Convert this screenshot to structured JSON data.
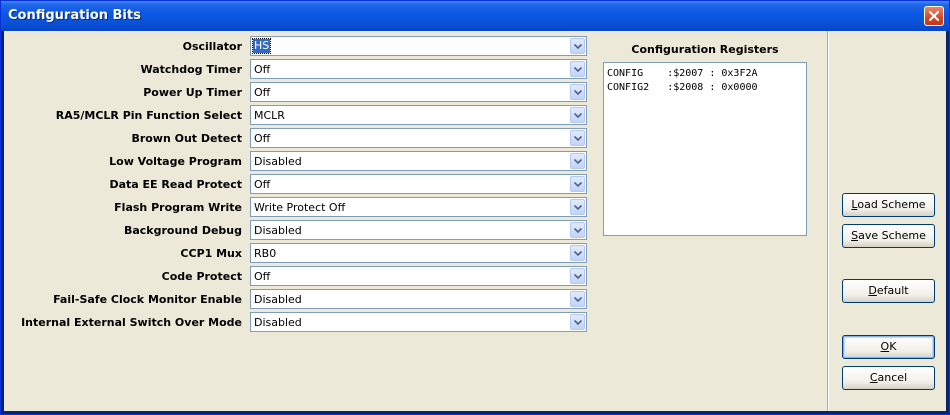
{
  "window": {
    "title": "Configuration Bits"
  },
  "settings": [
    {
      "label": "Oscillator",
      "value": "HS",
      "selected": true
    },
    {
      "label": "Watchdog Timer",
      "value": "Off"
    },
    {
      "label": "Power Up Timer",
      "value": "Off"
    },
    {
      "label": "RA5/MCLR Pin Function Select",
      "value": "MCLR"
    },
    {
      "label": "Brown Out Detect",
      "value": "Off"
    },
    {
      "label": "Low Voltage Program",
      "value": "Disabled"
    },
    {
      "label": "Data EE Read Protect",
      "value": "Off"
    },
    {
      "label": "Flash Program Write",
      "value": "Write Protect Off"
    },
    {
      "label": "Background Debug",
      "value": "Disabled"
    },
    {
      "label": "CCP1 Mux",
      "value": "RB0"
    },
    {
      "label": "Code Protect",
      "value": "Off"
    },
    {
      "label": "Fail-Safe Clock Monitor Enable",
      "value": "Disabled"
    },
    {
      "label": "Internal External Switch Over Mode",
      "value": "Disabled"
    }
  ],
  "registers": {
    "title": "Configuration Registers",
    "lines": [
      "CONFIG    :$2007 : 0x3F2A",
      "CONFIG2   :$2008 : 0x0000"
    ]
  },
  "buttons": {
    "load_scheme": {
      "mnemonic": "L",
      "rest": "oad Scheme"
    },
    "save_scheme": {
      "mnemonic": "S",
      "rest": "ave Scheme"
    },
    "default": {
      "mnemonic": "D",
      "rest": "efault"
    },
    "ok": {
      "mnemonic": "O",
      "rest": "K"
    },
    "cancel": {
      "mnemonic": "C",
      "rest": "ancel"
    }
  },
  "colors": {
    "titlebar": "#0a52d9",
    "face": "#ece9d8",
    "selection": "#316ac5",
    "close": "#d24725"
  },
  "icons": {
    "close": "close-x-icon",
    "dropdown": "chevron-down-icon"
  }
}
